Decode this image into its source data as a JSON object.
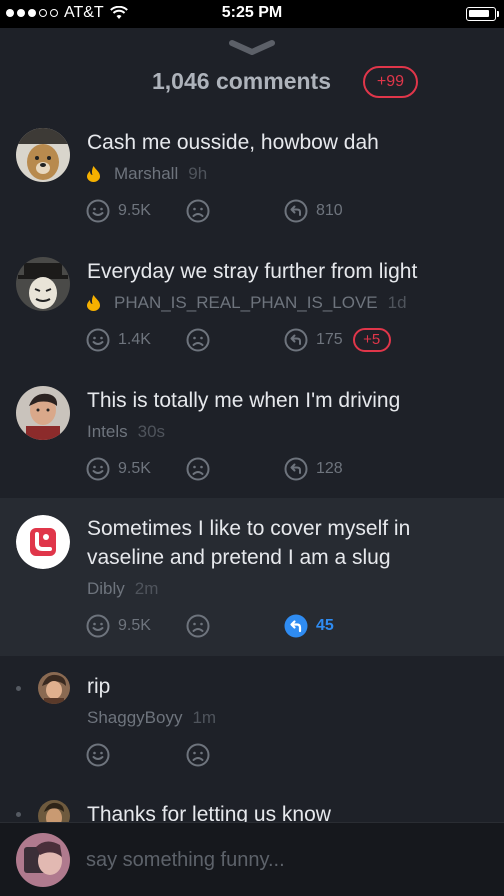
{
  "status_bar": {
    "carrier": "AT&T",
    "time": "5:25 PM",
    "battery_level": 0.85
  },
  "header": {
    "count_label": "1,046 comments",
    "new_badge": "+99"
  },
  "comments": [
    {
      "text": "Cash me ousside, howbow dah",
      "author": "Marshall",
      "age": "9h",
      "hot": true,
      "likes": "9.5K",
      "replies": "810"
    },
    {
      "text": "Everyday we stray further from light",
      "author": "PHAN_IS_REAL_PHAN_IS_LOVE",
      "age": "1d",
      "hot": true,
      "likes": "1.4K",
      "replies": "175",
      "new_replies": "+5"
    },
    {
      "text": "This is totally me when I'm driving",
      "author": "Intels",
      "age": "30s",
      "hot": false,
      "likes": "9.5K",
      "replies": "128"
    },
    {
      "text_line1": "Sometimes I like to cover myself in",
      "text_line2": "vaseline and pretend I am a slug",
      "author": "Dibly",
      "age": "2m",
      "hot": false,
      "likes": "9.5K",
      "replies": "45"
    },
    {
      "text": "rip",
      "author": "ShaggyBoyy",
      "age": "1m"
    },
    {
      "text": "Thanks for letting us know"
    }
  ],
  "composer": {
    "placeholder": "say something funny..."
  },
  "colors": {
    "background": "#1e2128",
    "accent_red": "#e0364a",
    "accent_blue": "#2f8cf2",
    "flame": "#f5b000"
  }
}
